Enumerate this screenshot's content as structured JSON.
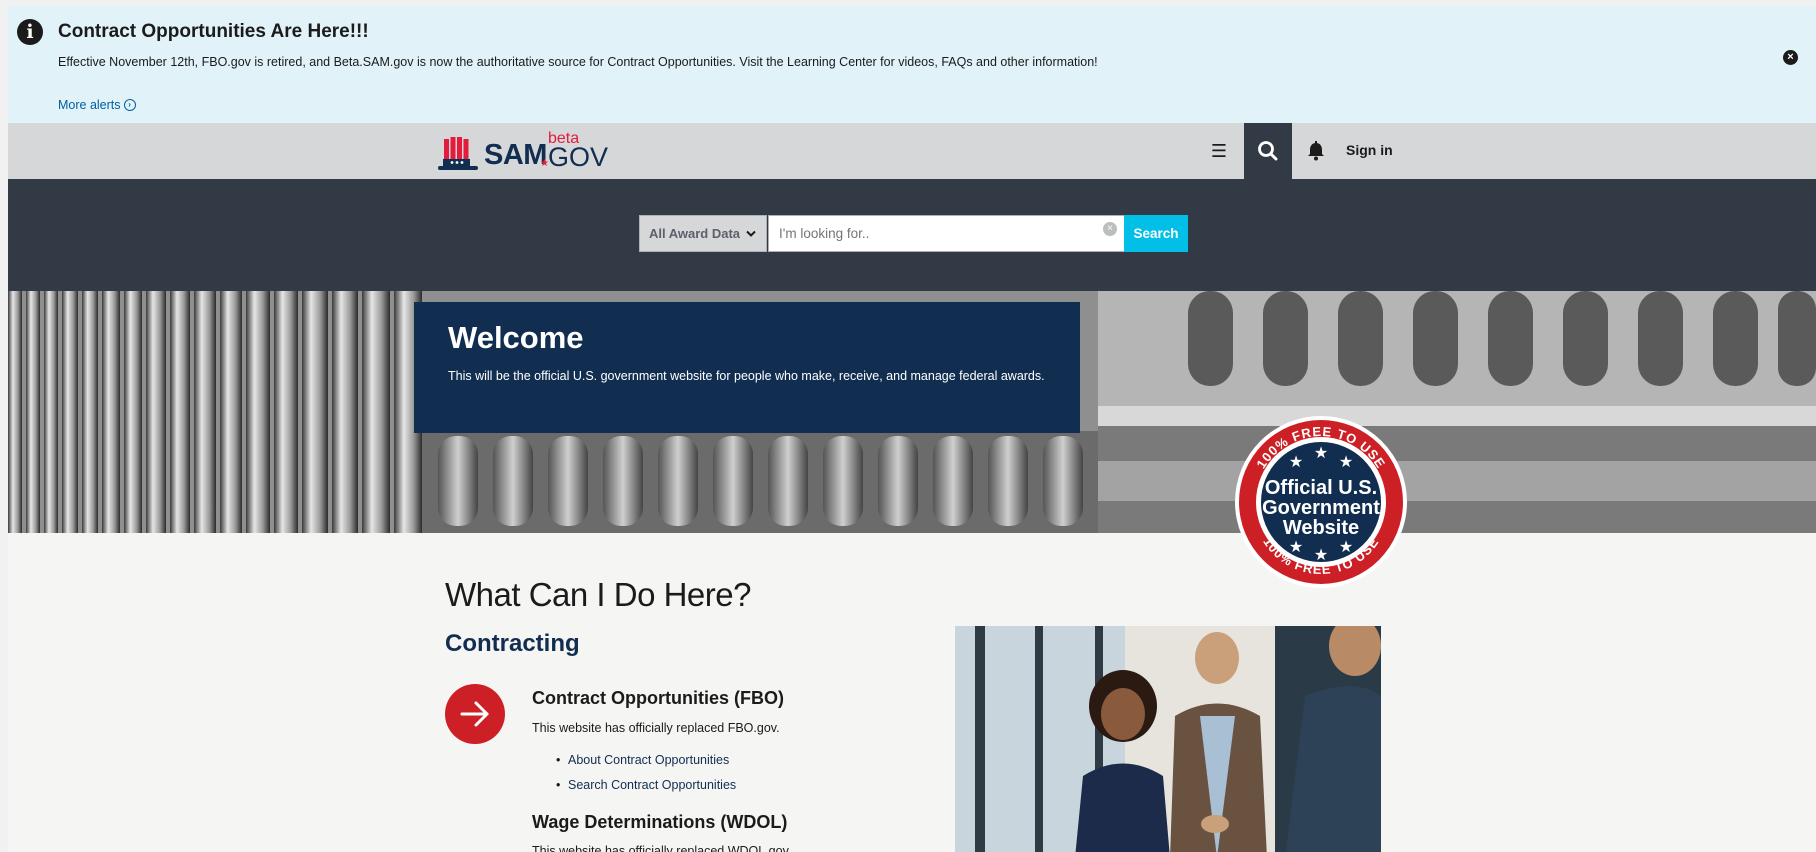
{
  "alert": {
    "icon": "info-icon",
    "title": "Contract Opportunities Are Here!!!",
    "body": "Effective November 12th, FBO.gov is retired, and Beta.SAM.gov is now the authoritative source for Contract Opportunities. Visit the Learning Center for videos, FAQs and other information!",
    "more_link": "More alerts",
    "close_icon": "close-icon"
  },
  "header": {
    "logo_text": "SAM",
    "logo_beta": "beta",
    "logo_gov": "GOV",
    "logo_dot": "★",
    "menu_icon": "hamburger-icon",
    "search_icon": "search-icon",
    "notification_icon": "bell-icon",
    "signin_label": "Sign in"
  },
  "search": {
    "domain_selected": "All Award Data",
    "placeholder": "I'm looking for..",
    "submit_label": "Search"
  },
  "hero": {
    "title": "Welcome",
    "text": "This will be the official U.S. government website for people who make, receive, and manage federal awards."
  },
  "seal": {
    "top_text": "100% FREE TO USE",
    "line1": "Official U.S.",
    "line2": "Government",
    "line3": "Website",
    "bottom_text": "100% FREE TO USE"
  },
  "content": {
    "heading": "What Can I Do Here?",
    "section": "Contracting",
    "items": [
      {
        "title": "Contract Opportunities (FBO)",
        "desc": "This website has officially replaced FBO.gov.",
        "links": [
          "About Contract Opportunities",
          "Search Contract Opportunities"
        ]
      },
      {
        "title": "Wage Determinations (WDOL)",
        "desc": "This website has officially replaced WDOL.gov."
      }
    ]
  },
  "colors": {
    "alert_bg": "#e1f3f8",
    "header_bg": "#d6d7d9",
    "search_band": "#323a45",
    "primary_navy": "#112e51",
    "accent_cyan": "#02bfe7",
    "accent_red": "#cd2026"
  }
}
